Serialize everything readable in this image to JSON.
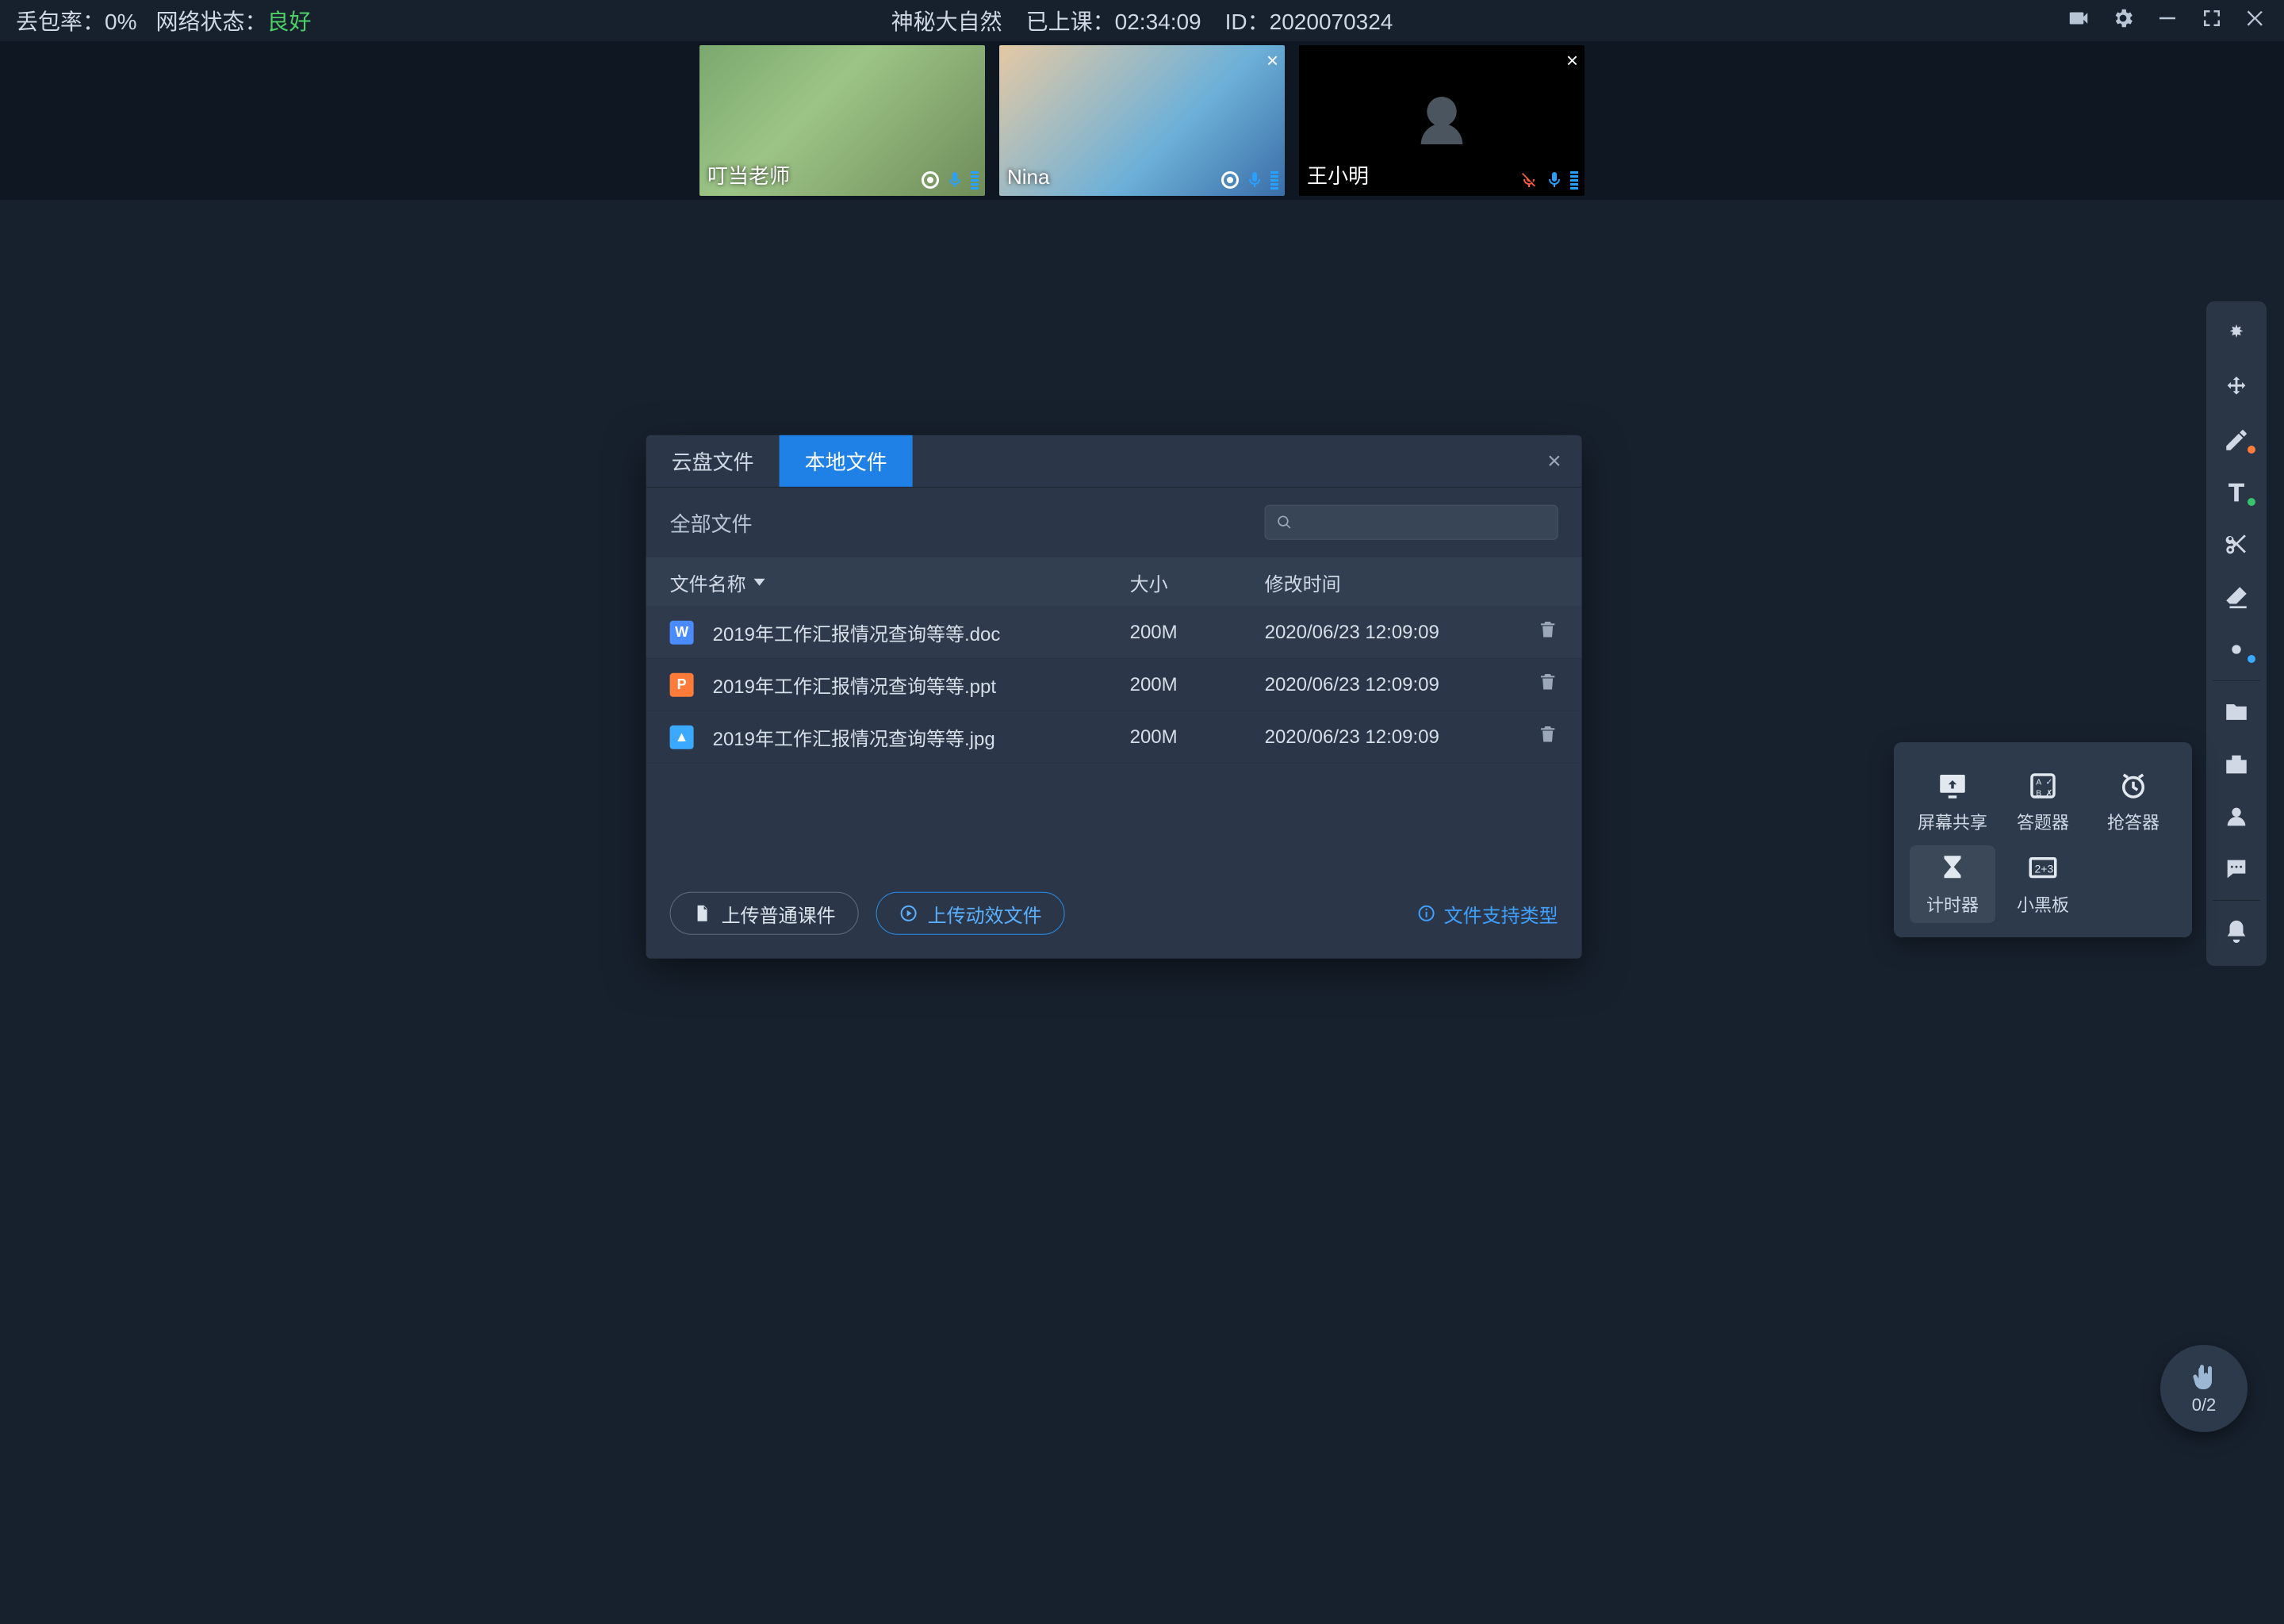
{
  "topbar": {
    "packet_loss_label": "丢包率：",
    "packet_loss_value": "0%",
    "network_label": "网络状态：",
    "network_value": "良好",
    "title": "神秘大自然",
    "elapsed_label": "已上课：",
    "elapsed_value": "02:34:09",
    "id_label": "ID：",
    "id_value": "2020070324"
  },
  "participants": [
    {
      "name": "叮当老师",
      "camera": true,
      "mic": "on",
      "closable": false,
      "rec": true
    },
    {
      "name": "Nina",
      "camera": true,
      "mic": "on",
      "closable": true,
      "rec": true
    },
    {
      "name": "王小明",
      "camera": false,
      "mic": "on_muted",
      "closable": true,
      "rec": false
    }
  ],
  "modal": {
    "tab_cloud": "云盘文件",
    "tab_local": "本地文件",
    "all_files": "全部文件",
    "search_placeholder": "",
    "col_name": "文件名称",
    "col_size": "大小",
    "col_modified": "修改时间",
    "rows": [
      {
        "icon": "w",
        "name": "2019年工作汇报情况查询等等.doc",
        "size": "200M",
        "modified": "2020/06/23 12:09:09"
      },
      {
        "icon": "p",
        "name": "2019年工作汇报情况查询等等.ppt",
        "size": "200M",
        "modified": "2020/06/23 12:09:09"
      },
      {
        "icon": "i",
        "name": "2019年工作汇报情况查询等等.jpg",
        "size": "200M",
        "modified": "2020/06/23 12:09:09"
      }
    ],
    "upload_plain": "上传普通课件",
    "upload_anim": "上传动效文件",
    "support_link": "文件支持类型"
  },
  "popover": {
    "screen_share": "屏幕共享",
    "answer": "答题器",
    "quiz": "抢答器",
    "timer": "计时器",
    "blackboard": "小黑板"
  },
  "hand": {
    "count": "0/2"
  }
}
